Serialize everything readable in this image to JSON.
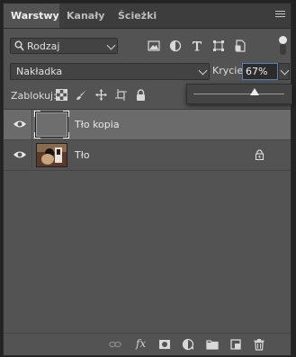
{
  "tabs": [
    {
      "label": "Warstwy",
      "active": true
    },
    {
      "label": "Kanały",
      "active": false
    },
    {
      "label": "Ścieżki",
      "active": false
    }
  ],
  "filter": {
    "kind_label": "Rodzaj"
  },
  "blend": {
    "mode": "Nakładka"
  },
  "opacity": {
    "label": "Krycie:",
    "value": "67%",
    "slider_fraction": 0.67
  },
  "lock": {
    "label": "Zablokuj:"
  },
  "layers": [
    {
      "name": "Tło kopia",
      "selected": true,
      "visible": true,
      "locked": false
    },
    {
      "name": "Tło",
      "selected": false,
      "visible": true,
      "locked": true
    }
  ],
  "colors": {
    "panel": "#535353",
    "selected_row": "#6b6b6b",
    "tab_bar": "#3d3d3d",
    "accent": "#5d7fb8"
  },
  "icons": {
    "filter": [
      "pixel-filter-icon",
      "adjustment-filter-icon",
      "type-filter-icon",
      "shape-filter-icon",
      "smart-object-filter-icon"
    ],
    "lock": [
      "lock-transparent-icon",
      "lock-image-icon",
      "lock-position-icon",
      "lock-artboard-icon",
      "lock-all-icon"
    ],
    "bottom": [
      "link-layers-icon",
      "fx-icon",
      "add-mask-icon",
      "new-adjustment-icon",
      "new-group-icon",
      "new-layer-icon",
      "delete-layer-icon"
    ]
  }
}
